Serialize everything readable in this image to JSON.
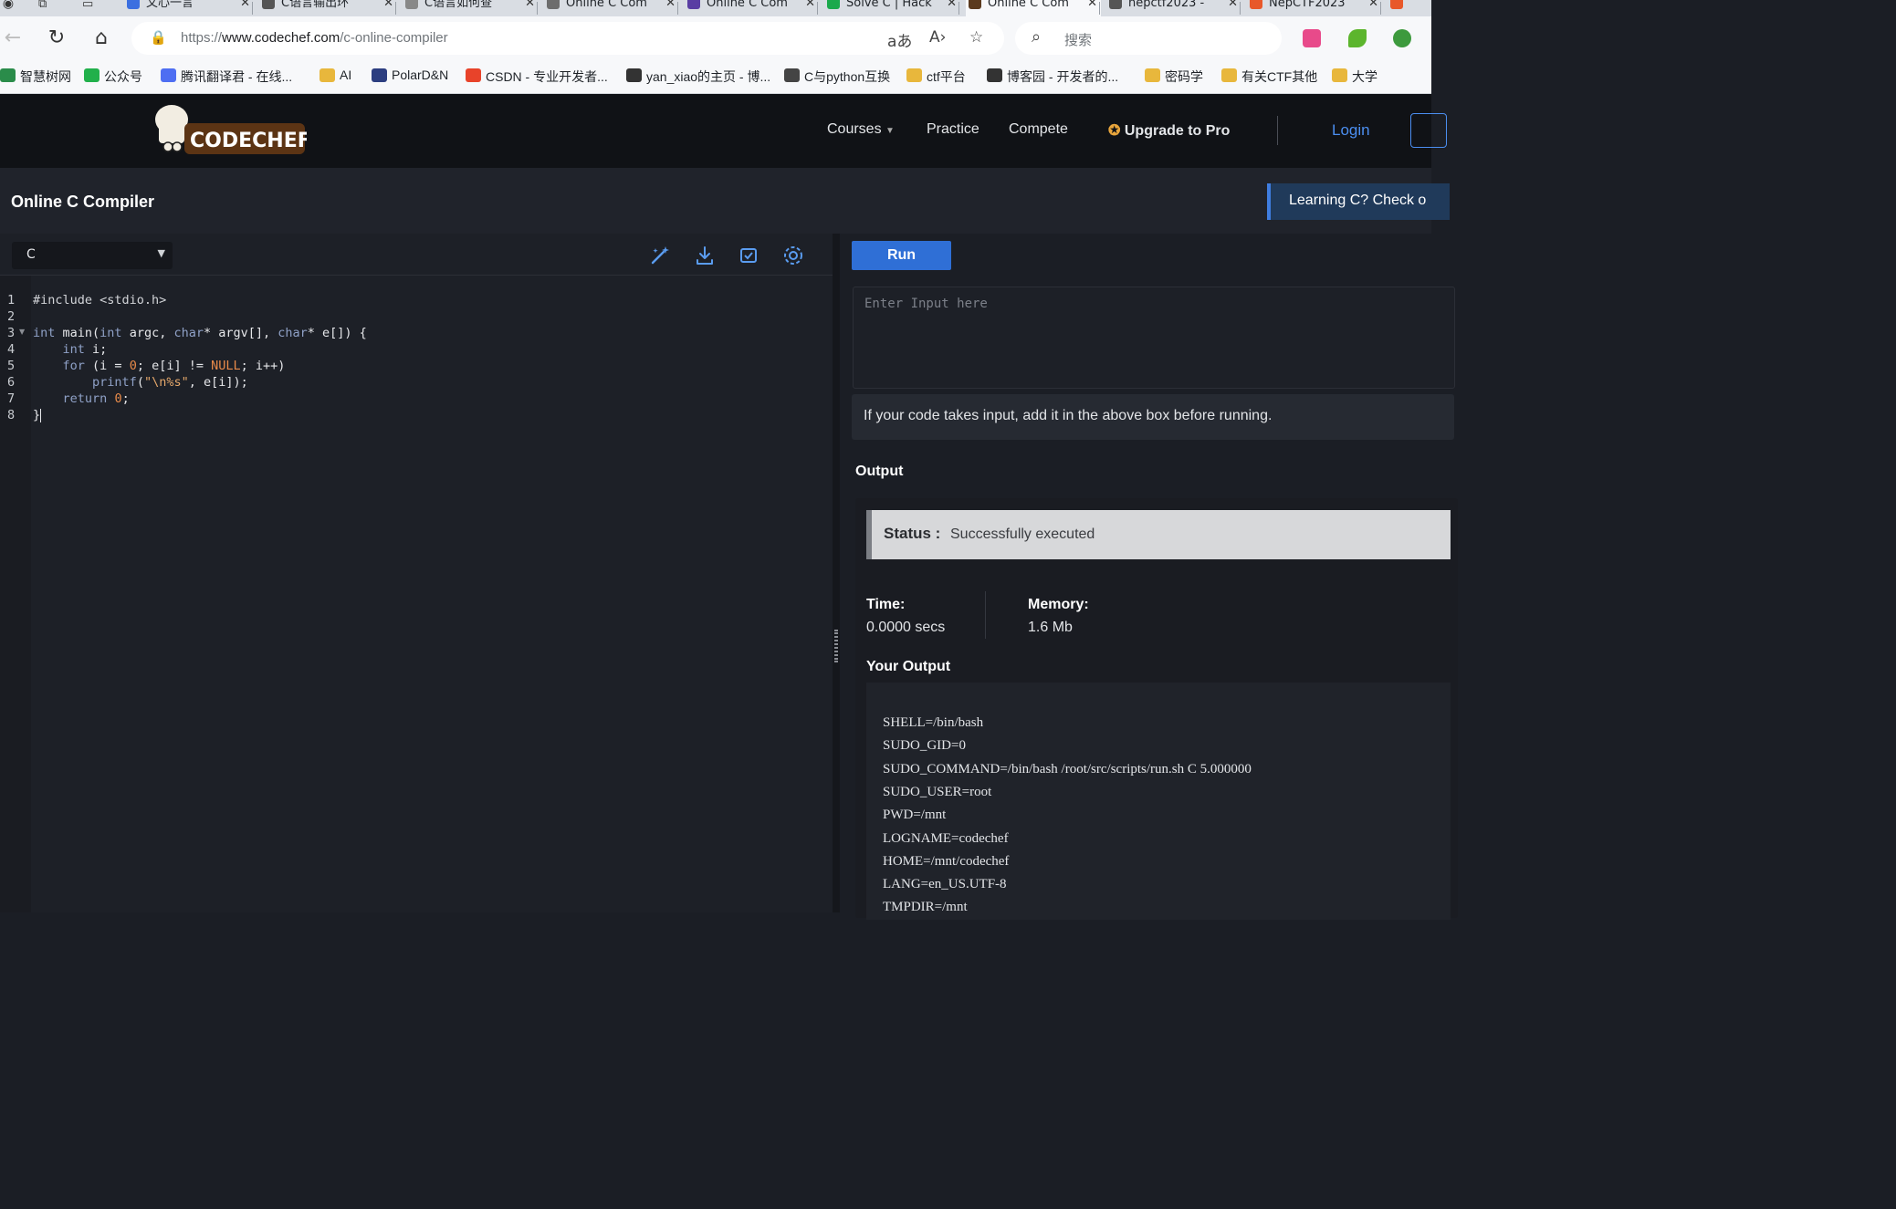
{
  "browser": {
    "tabs": [
      {
        "label": "文心一言",
        "color": "#3b6fe0"
      },
      {
        "label": "C语言输出环",
        "color": "#555555"
      },
      {
        "label": "C语言如何查",
        "color": "#888888"
      },
      {
        "label": "Online C Com",
        "color": "#6d6d6d"
      },
      {
        "label": "Online C Com",
        "color": "#5a3ea3"
      },
      {
        "label": "Solve C | Hack",
        "color": "#1ba94c"
      },
      {
        "label": "Online C Com",
        "color": "#5b3a1e"
      },
      {
        "label": "nepctf2023 -",
        "color": "#555555"
      },
      {
        "label": "NepCTF2023",
        "color": "#e8582a"
      },
      {
        "label": "",
        "color": "#e8582a"
      }
    ],
    "url_prefix": "https://",
    "url_host": "www.codechef.com",
    "url_path": "/c-online-compiler",
    "search_placeholder": "搜索",
    "bookmarks": [
      {
        "label": "智慧树网",
        "color": "#2a8c4a"
      },
      {
        "label": "公众号",
        "color": "#21b04b"
      },
      {
        "label": "腾讯翻译君 - 在线...",
        "color": "#4e6ef2"
      },
      {
        "label": "AI",
        "color": "folder"
      },
      {
        "label": "PolarD&N",
        "color": "#2c3e80"
      },
      {
        "label": "CSDN - 专业开发者...",
        "color": "#e8432a"
      },
      {
        "label": "yan_xiao的主页 - 博...",
        "color": "#333333"
      },
      {
        "label": "C与python互换",
        "color": "#444444"
      },
      {
        "label": "ctf平台",
        "color": "folder"
      },
      {
        "label": "博客园 - 开发者的...",
        "color": "#333333"
      },
      {
        "label": "密码学",
        "color": "folder"
      },
      {
        "label": "有关CTF其他",
        "color": "folder"
      },
      {
        "label": "大学",
        "color": "folder"
      }
    ]
  },
  "site": {
    "logo_text": "CODECHEF",
    "nav": {
      "courses": "Courses",
      "practice": "Practice",
      "compete": "Compete",
      "upgrade": "Upgrade to Pro",
      "login": "Login"
    },
    "page_title": "Online C Compiler",
    "banner": "Learning C? Check o"
  },
  "editor": {
    "language": "C",
    "line_numbers": [
      "1",
      "2",
      "3",
      "4",
      "5",
      "6",
      "7",
      "8"
    ]
  },
  "io": {
    "run_label": "Run",
    "input_placeholder": "Enter Input here",
    "hint": "If your code takes input, add it in the above box before running.",
    "output_title": "Output",
    "status_label": "Status :",
    "status_value": "Successfully executed",
    "time_label": "Time:",
    "time_value": "0.0000 secs",
    "memory_label": "Memory:",
    "memory_value": "1.6 Mb",
    "your_output_label": "Your Output",
    "output_lines": [
      "SHELL=/bin/bash",
      "SUDO_GID=0",
      "SUDO_COMMAND=/bin/bash /root/src/scripts/run.sh C 5.000000",
      "SUDO_USER=root",
      "PWD=/mnt",
      "LOGNAME=codechef",
      "HOME=/mnt/codechef",
      "LANG=en_US.UTF-8",
      "TMPDIR=/mnt"
    ]
  },
  "colors": {
    "run_button": "#2f6fd6",
    "login_link": "#4b8ef0",
    "header_bg": "#101216"
  }
}
